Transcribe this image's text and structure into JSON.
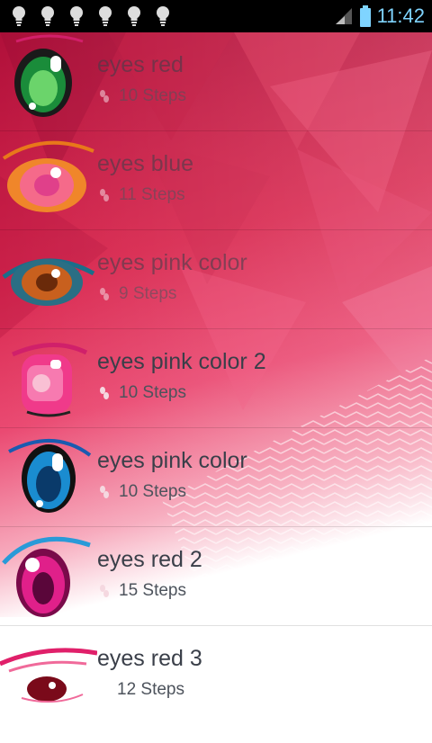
{
  "status_bar": {
    "time": "11:42",
    "notification_count": 6
  },
  "items": [
    {
      "title": "eyes red",
      "steps": "10 Steps",
      "thumb_icon": "anime-eye-green-icon"
    },
    {
      "title": "eyes blue",
      "steps": "11 Steps",
      "thumb_icon": "anime-eye-orange-icon"
    },
    {
      "title": "eyes pink color",
      "steps": "9 Steps",
      "thumb_icon": "anime-eye-brown-icon"
    },
    {
      "title": "eyes pink color 2",
      "steps": "10 Steps",
      "thumb_icon": "anime-eye-pink-icon"
    },
    {
      "title": "eyes pink color",
      "steps": "10 Steps",
      "thumb_icon": "anime-eye-blue-icon"
    },
    {
      "title": "eyes red 2",
      "steps": "15 Steps",
      "thumb_icon": "anime-eye-magenta-icon"
    },
    {
      "title": "eyes red 3",
      "steps": "12 Steps",
      "thumb_icon": "anime-eye-red-icon"
    }
  ],
  "colors": {
    "background_top": "#b8123a",
    "background_mid": "#e83a63",
    "background_bottom": "#ffffff",
    "text_primary": "#3a3f49",
    "clock": "#7fd4ff"
  }
}
